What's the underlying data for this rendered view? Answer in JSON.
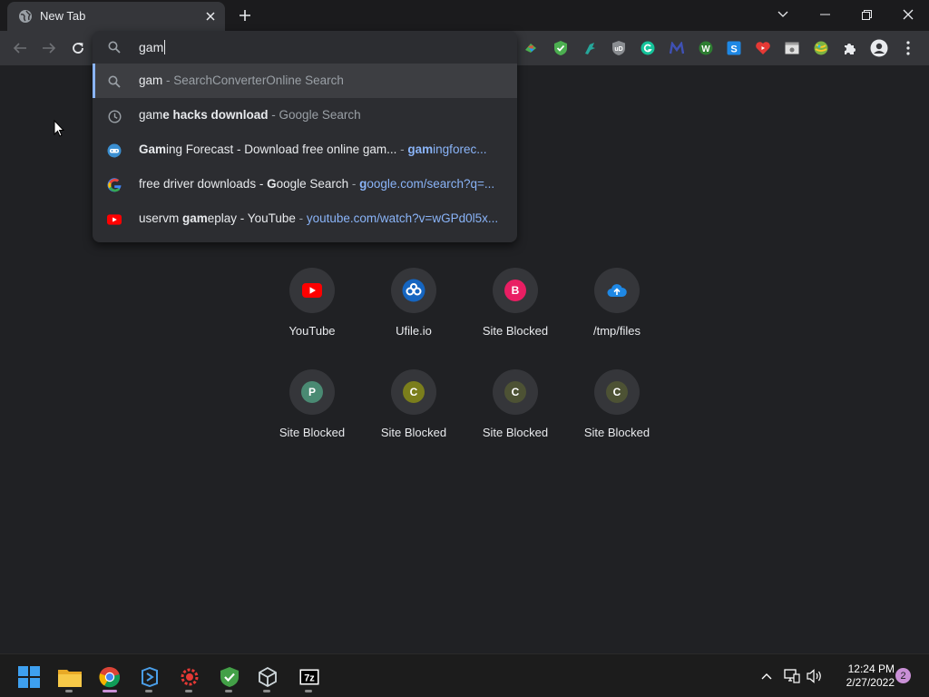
{
  "tab": {
    "title": "New Tab"
  },
  "omnibox": {
    "value": "gam",
    "suggestions": [
      {
        "parts": [
          {
            "t": "gam",
            "c": "dim0"
          },
          {
            "t": " - SearchConverterOnline Search",
            "c": "dim"
          }
        ],
        "icon": "search-icon"
      },
      {
        "parts": [
          {
            "t": "gam",
            "c": ""
          },
          {
            "t": "e hacks download",
            "c": "b"
          },
          {
            "t": " - Google Search",
            "c": "dim"
          }
        ],
        "icon": "history-icon"
      },
      {
        "parts": [
          {
            "t": "Gam",
            "c": "b"
          },
          {
            "t": "ing Forecast - Download free online gam...",
            "c": ""
          },
          {
            "t": "   - ",
            "c": "dim"
          },
          {
            "t": "gam",
            "c": "url b"
          },
          {
            "t": "ingforec...",
            "c": "url"
          }
        ],
        "icon": "gaming-forecast-icon"
      },
      {
        "parts": [
          {
            "t": "free driver downloads - ",
            "c": ""
          },
          {
            "t": "G",
            "c": "b"
          },
          {
            "t": "oogle Search",
            "c": ""
          },
          {
            "t": " - ",
            "c": "dim"
          },
          {
            "t": "g",
            "c": "url b"
          },
          {
            "t": "oogle.com/search?q=...",
            "c": "url"
          }
        ],
        "icon": "google-icon"
      },
      {
        "parts": [
          {
            "t": "uservm ",
            "c": ""
          },
          {
            "t": "gam",
            "c": "b"
          },
          {
            "t": "eplay - YouTube",
            "c": ""
          },
          {
            "t": " - ",
            "c": "dim"
          },
          {
            "t": "youtube.com/watch?v=wGPd0l5x...",
            "c": "url"
          }
        ],
        "icon": "youtube-icon"
      }
    ]
  },
  "shortcuts": [
    {
      "label": "YouTube",
      "icon": "youtube-icon"
    },
    {
      "label": "Ufile.io",
      "icon": "ufile-icon"
    },
    {
      "label": "Site Blocked",
      "letter": "B",
      "color": "#e91e63"
    },
    {
      "label": "/tmp/files",
      "icon": "cloud-upload-icon"
    },
    {
      "label": "Site Blocked",
      "letter": "P",
      "color": "#4a8a73"
    },
    {
      "label": "Site Blocked",
      "letter": "C",
      "color": "#7b7e1c"
    },
    {
      "label": "Site Blocked",
      "letter": "C",
      "color": "#4d5234"
    },
    {
      "label": "Site Blocked",
      "letter": "C",
      "color": "#4d5234"
    }
  ],
  "taskbar": {
    "time": "12:24 PM",
    "date": "2/27/2022",
    "notifications": "2"
  },
  "colors": {
    "accent": "#8ab4f8",
    "background": "#202124",
    "toolbar": "#35363a"
  }
}
